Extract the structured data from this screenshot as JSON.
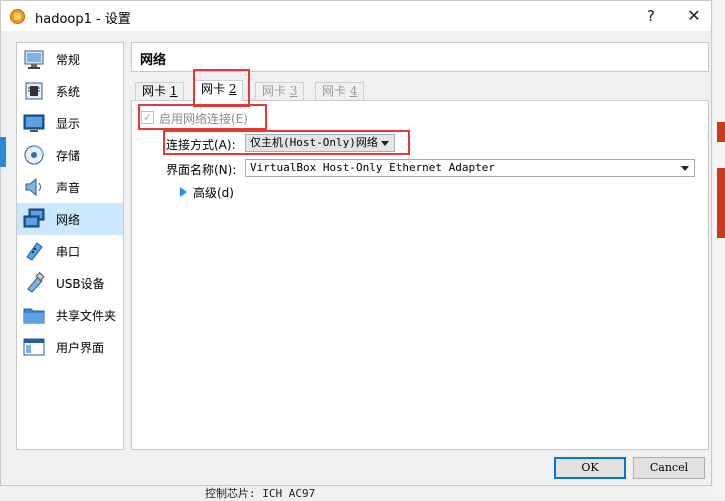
{
  "window": {
    "title": "hadoop1 - 设置",
    "help_glyph": "?",
    "close_glyph": "✕"
  },
  "sidebar": {
    "items": [
      {
        "label": "常规",
        "icon": "general-icon"
      },
      {
        "label": "系统",
        "icon": "system-icon"
      },
      {
        "label": "显示",
        "icon": "display-icon"
      },
      {
        "label": "存储",
        "icon": "storage-icon"
      },
      {
        "label": "声音",
        "icon": "audio-icon"
      },
      {
        "label": "网络",
        "icon": "network-icon",
        "selected": true
      },
      {
        "label": "串口",
        "icon": "serial-port-icon"
      },
      {
        "label": "USB设备",
        "icon": "usb-icon"
      },
      {
        "label": "共享文件夹",
        "icon": "shared-folder-icon"
      },
      {
        "label": "用户界面",
        "icon": "user-interface-icon"
      }
    ]
  },
  "panel": {
    "title": "网络",
    "tabs": [
      {
        "label": "网卡 ",
        "key": "1",
        "state": "normal"
      },
      {
        "label": "网卡 ",
        "key": "2",
        "state": "active"
      },
      {
        "label": "网卡 ",
        "key": "3",
        "state": "disabled"
      },
      {
        "label": "网卡 ",
        "key": "4",
        "state": "disabled"
      }
    ],
    "enable_adapter": {
      "label": "启用网络连接(E)",
      "checked": true,
      "mark": "✓"
    },
    "attached_to": {
      "label": "连接方式(A):",
      "value": "仅主机(Host-Only)网络"
    },
    "interface_name": {
      "label": "界面名称(N):",
      "value": "VirtualBox Host-Only Ethernet Adapter"
    },
    "advanced": {
      "label": "高级(d)"
    }
  },
  "buttons": {
    "ok": "OK",
    "cancel": "Cancel"
  },
  "background": {
    "bottom_text": "控制芯片:     ICH AC97"
  },
  "colors": {
    "selected_bg": "#cce8ff",
    "highlight": "#e53935",
    "accent": "#0078d7"
  }
}
